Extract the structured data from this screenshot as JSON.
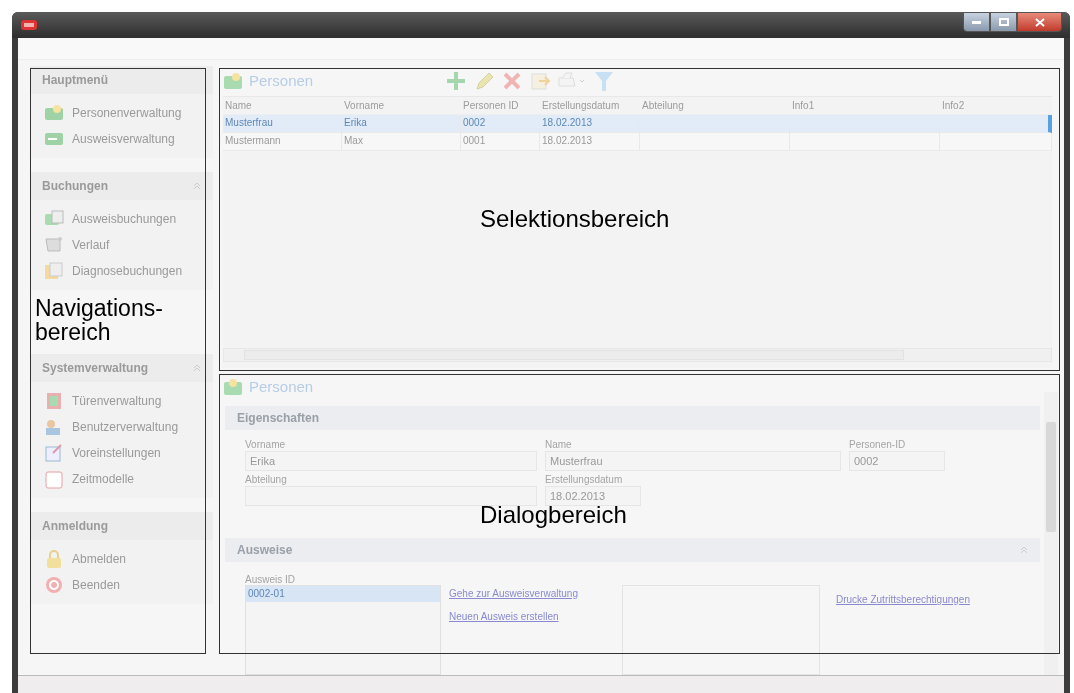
{
  "navigation": [
    {
      "title": "Hauptmenü",
      "collapsible": false,
      "items": [
        {
          "label": "Personenverwaltung"
        },
        {
          "label": "Ausweisverwaltung"
        }
      ]
    },
    {
      "title": "Buchungen",
      "collapsible": true,
      "items": [
        {
          "label": "Ausweisbuchungen"
        },
        {
          "label": "Verlauf"
        },
        {
          "label": "Diagnosebuchungen"
        }
      ]
    },
    {
      "title": "Systemverwaltung",
      "collapsible": true,
      "items": [
        {
          "label": "Türenverwaltung"
        },
        {
          "label": "Benutzerverwaltung"
        },
        {
          "label": "Voreinstellungen"
        },
        {
          "label": "Zeitmodelle"
        }
      ]
    },
    {
      "title": "Anmeldung",
      "collapsible": false,
      "items": [
        {
          "label": "Abmelden"
        },
        {
          "label": "Beenden"
        }
      ]
    }
  ],
  "selection": {
    "title": "Personen",
    "table": {
      "columns": [
        "Name",
        "Vorname",
        "Personen ID",
        "Erstellungsdatum",
        "Abteilung",
        "Info1",
        "Info2"
      ],
      "rows": [
        {
          "selected": true,
          "cells": [
            "Musterfrau",
            "Erika",
            "0002",
            "18.02.2013"
          ]
        },
        {
          "selected": false,
          "cells": [
            "Mustermann",
            "Max",
            "0001",
            "18.02.2013"
          ]
        }
      ]
    }
  },
  "dialog": {
    "title": "Personen",
    "properties": {
      "title": "Eigenschaften",
      "fields": [
        {
          "label": "Vorname",
          "value": "Erika"
        },
        {
          "label": "Name",
          "value": "Musterfrau"
        },
        {
          "label": "Personen-ID",
          "value": "0002"
        },
        {
          "label": "Abteilung"
        },
        {
          "label": "Erstellungsdatum",
          "value": "18.02.2013"
        }
      ]
    },
    "badges": {
      "title": "Ausweise",
      "list_label": "Ausweis ID",
      "ids": [
        {
          "label": "0002-01",
          "selected": true
        }
      ],
      "links": [
        "Gehe zur Ausweisverwaltung",
        "Neuen Ausweis erstellen",
        "Drucke Zutrittsberechtigungen"
      ]
    }
  },
  "annotations": [
    {
      "kind": "navigation",
      "lines": [
        "Navigations-",
        "bereich"
      ]
    },
    {
      "kind": "selection",
      "lines": [
        "Selektionsbereich"
      ]
    },
    {
      "kind": "dialog",
      "lines": [
        "Dialogbereich"
      ]
    }
  ]
}
